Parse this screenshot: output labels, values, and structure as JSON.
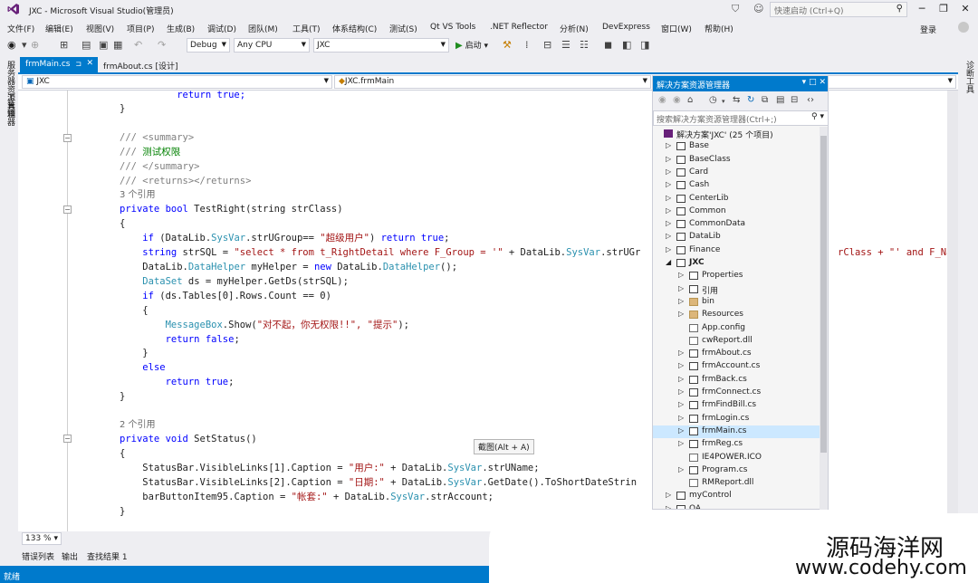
{
  "window": {
    "title": "JXC - Microsoft Visual Studio(管理员)",
    "quick_launch_placeholder": "快速启动 (Ctrl+Q)",
    "minimize": "─",
    "restore": "❐",
    "close": "✕"
  },
  "menu": [
    "文件(F)",
    "编辑(E)",
    "视图(V)",
    "项目(P)",
    "生成(B)",
    "调试(D)",
    "团队(M)",
    "工具(T)",
    "体系结构(C)",
    "测试(S)",
    "Qt VS Tools",
    ".NET Reflector",
    "分析(N)",
    "DevExpress",
    "窗口(W)",
    "帮助(H)"
  ],
  "signin": "登录",
  "toolbar": {
    "config": "Debug",
    "platform": "Any CPU",
    "project": "JXC",
    "start": "启动"
  },
  "side": {
    "left_top": "服务器资源管理器",
    "left_bottom": "工具箱",
    "right": "诊断工具"
  },
  "tabs": [
    {
      "label": "frmMain.cs",
      "active": true
    },
    {
      "label": "frmAbout.cs [设计]",
      "active": false
    }
  ],
  "nav": {
    "project": "JXC",
    "class": "JXC.frmMain"
  },
  "code": {
    "l1_indent": "            ",
    "ret_true": "return true;",
    "brace_close": "}",
    "brace_open": "{",
    "summary_open": "/// <summary>",
    "summary_text": "测试权限",
    "summary_close": "/// </summary>",
    "returns": "/// <returns></returns>",
    "refs3": "3 个引用",
    "sig1_kw": "private bool",
    "sig1_rest": " TestRight(string strClass)",
    "if1": "if (DataLib.",
    "sysvar": "SysVar",
    "if1_rest": ".strUGroup== ",
    "if1_str": "\"超级用户\"",
    "if1_end": ") return true;",
    "sql_pre": "string strSQL = ",
    "sql_str": "\"select * from t_RightDetail where F_Group = '\"",
    "sql_mid": " + DataLib.",
    "sql_rest": ".strUGr",
    "sql_tail": "rClass + \"' and F_Na",
    "helper_pre": "DataLib.",
    "datahelper": "DataHelper",
    "helper_mid": " myHelper = new DataLib.",
    "helper_end": "();",
    "dataset": "DataSet",
    "ds_rest": " ds = myHelper.GetDs(strSQL);",
    "if2": "if (ds.Tables[0].Rows.Count == 0)",
    "msgbox": "MessageBox",
    "msg_pre": ".Show(",
    "msg_str": "\"对不起，你无权限!!\", \"提示\"",
    "msg_end": ");",
    "ret_false": "return false;",
    "else": "else",
    "refs2": "2 个引用",
    "sig2_kw": "private void",
    "sig2_rest": " SetStatus()",
    "sb1_pre": "StatusBar.VisibleLinks[1].Caption = ",
    "sb1_str": "\"用户:\"",
    "sb1_end": ".strUName;",
    "sb2_pre": "StatusBar.VisibleLinks[2].Caption = ",
    "sb2_str": "\"日期:\"",
    "sb2_end": ".GetDate().ToShortDateStrin",
    "bb_pre": "barButtonItem95.Caption = ",
    "bb_str": "\"帐套:\"",
    "bb_end": ".strAccount;",
    "plus_datalib": " + DataLib."
  },
  "tooltip": "截图(Alt + A)",
  "zoom": "133 %",
  "tool_tabs": [
    "错误列表",
    "输出",
    "查找结果 1"
  ],
  "status": "就绪",
  "solution_explorer": {
    "title": "解决方案资源管理器",
    "search_placeholder": "搜索解决方案资源管理器(Ctrl+;)",
    "items": [
      {
        "label": "解决方案'JXC' (25 个项目)",
        "level": 0,
        "exp": "",
        "type": "sln"
      },
      {
        "label": "Base",
        "level": 1,
        "exp": "▷",
        "type": "proj"
      },
      {
        "label": "BaseClass",
        "level": 1,
        "exp": "▷",
        "type": "proj"
      },
      {
        "label": "Card",
        "level": 1,
        "exp": "▷",
        "type": "proj"
      },
      {
        "label": "Cash",
        "level": 1,
        "exp": "▷",
        "type": "proj"
      },
      {
        "label": "CenterLib",
        "level": 1,
        "exp": "▷",
        "type": "proj"
      },
      {
        "label": "Common",
        "level": 1,
        "exp": "▷",
        "type": "proj"
      },
      {
        "label": "CommonData",
        "level": 1,
        "exp": "▷",
        "type": "proj"
      },
      {
        "label": "DataLib",
        "level": 1,
        "exp": "▷",
        "type": "proj"
      },
      {
        "label": "Finance",
        "level": 1,
        "exp": "▷",
        "type": "proj"
      },
      {
        "label": "JXC",
        "level": 1,
        "exp": "◢",
        "type": "proj"
      },
      {
        "label": "Properties",
        "level": 2,
        "exp": "▷",
        "type": "wrench"
      },
      {
        "label": "引用",
        "level": 2,
        "exp": "▷",
        "type": "ref"
      },
      {
        "label": "bin",
        "level": 2,
        "exp": "▷",
        "type": "folder"
      },
      {
        "label": "Resources",
        "level": 2,
        "exp": "▷",
        "type": "folder"
      },
      {
        "label": "App.config",
        "level": 2,
        "exp": "",
        "type": "file"
      },
      {
        "label": "cwReport.dll",
        "level": 2,
        "exp": "",
        "type": "file"
      },
      {
        "label": "frmAbout.cs",
        "level": 2,
        "exp": "▷",
        "type": "form"
      },
      {
        "label": "frmAccount.cs",
        "level": 2,
        "exp": "▷",
        "type": "form"
      },
      {
        "label": "frmBack.cs",
        "level": 2,
        "exp": "▷",
        "type": "form"
      },
      {
        "label": "frmConnect.cs",
        "level": 2,
        "exp": "▷",
        "type": "form"
      },
      {
        "label": "frmFindBill.cs",
        "level": 2,
        "exp": "▷",
        "type": "form"
      },
      {
        "label": "frmLogin.cs",
        "level": 2,
        "exp": "▷",
        "type": "form"
      },
      {
        "label": "frmMain.cs",
        "level": 2,
        "exp": "▷",
        "type": "form",
        "selected": true
      },
      {
        "label": "frmReg.cs",
        "level": 2,
        "exp": "▷",
        "type": "form"
      },
      {
        "label": "IE4POWER.ICO",
        "level": 2,
        "exp": "",
        "type": "file"
      },
      {
        "label": "Program.cs",
        "level": 2,
        "exp": "▷",
        "type": "cs"
      },
      {
        "label": "RMReport.dll",
        "level": 2,
        "exp": "",
        "type": "file"
      },
      {
        "label": "myControl",
        "level": 1,
        "exp": "▷",
        "type": "proj"
      },
      {
        "label": "OA",
        "level": 1,
        "exp": "▷",
        "type": "proj"
      }
    ]
  },
  "watermark": {
    "cn": "源码海洋网",
    "url": "www.codehy.com"
  },
  "colors": {
    "accent": "#007acc",
    "keyword": "#0000ff",
    "comment": "#008000",
    "string": "#a31515",
    "type": "#2b91af"
  }
}
